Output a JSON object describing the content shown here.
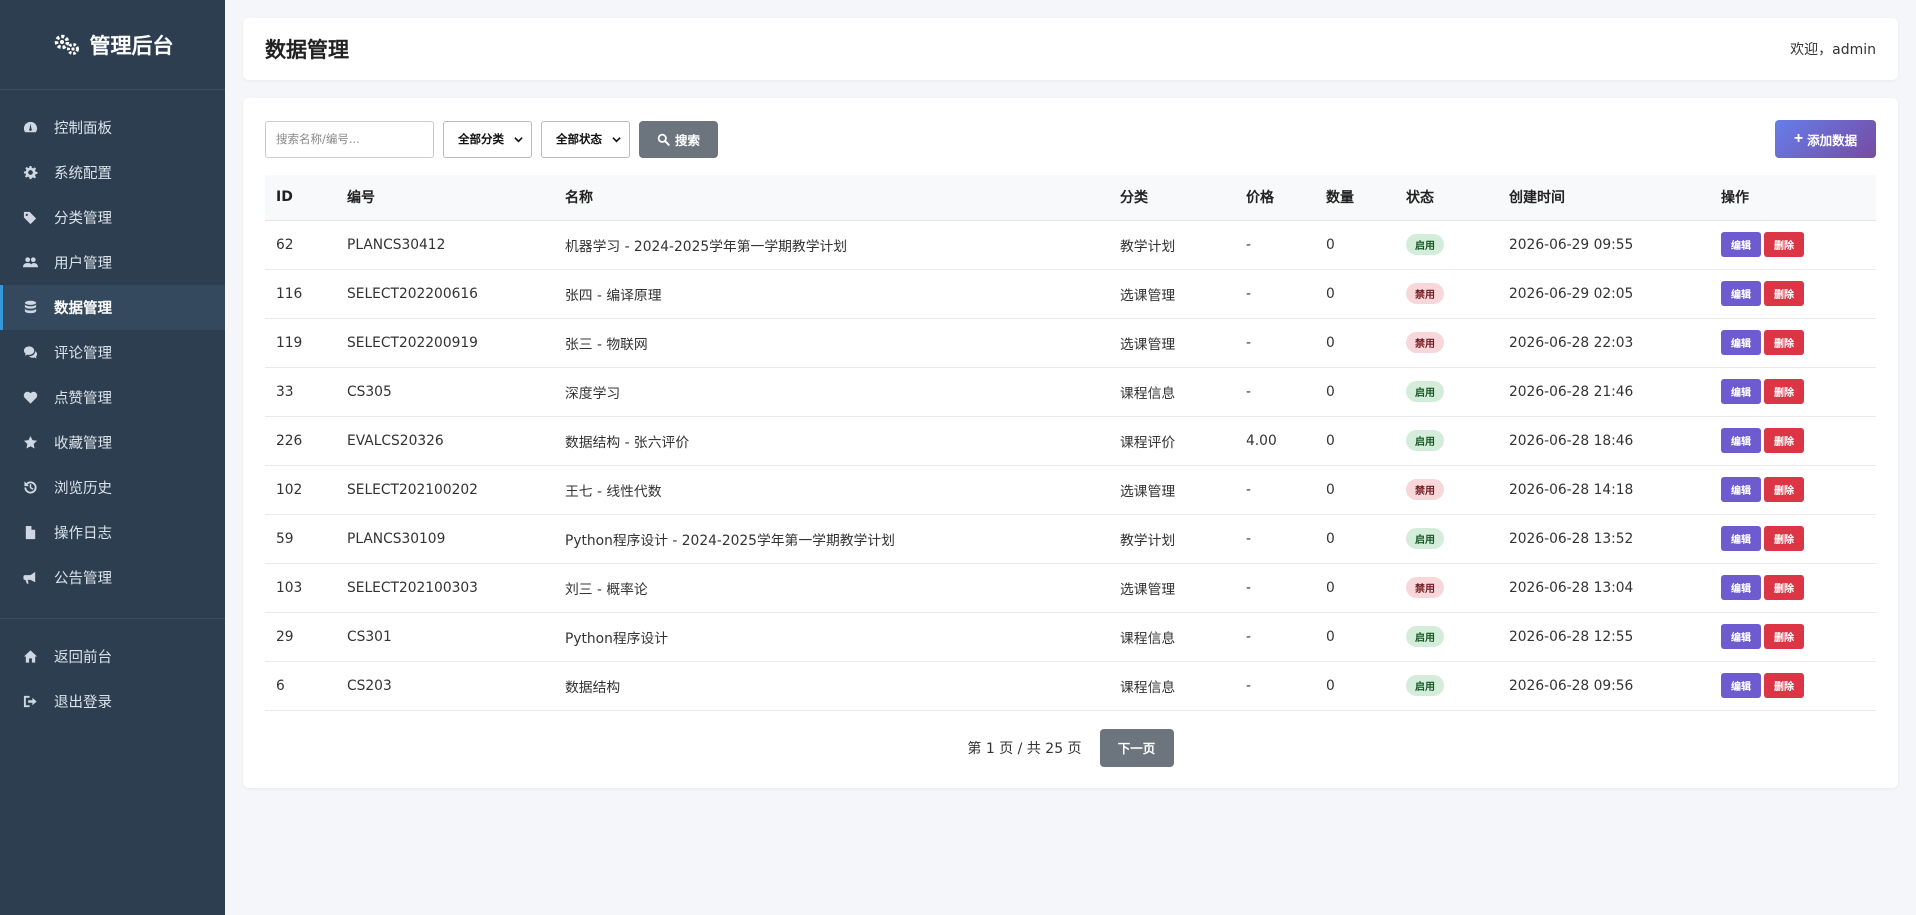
{
  "sidebar": {
    "brand": "管理后台",
    "items": [
      {
        "label": "控制面板",
        "icon": "dashboard-icon"
      },
      {
        "label": "系统配置",
        "icon": "gear-icon"
      },
      {
        "label": "分类管理",
        "icon": "tags-icon"
      },
      {
        "label": "用户管理",
        "icon": "users-icon"
      },
      {
        "label": "数据管理",
        "icon": "database-icon",
        "active": true
      },
      {
        "label": "评论管理",
        "icon": "comments-icon"
      },
      {
        "label": "点赞管理",
        "icon": "heart-icon"
      },
      {
        "label": "收藏管理",
        "icon": "star-icon"
      },
      {
        "label": "浏览历史",
        "icon": "history-icon"
      },
      {
        "label": "操作日志",
        "icon": "file-icon"
      },
      {
        "label": "公告管理",
        "icon": "bullhorn-icon"
      }
    ],
    "bottom": [
      {
        "label": "返回前台",
        "icon": "home-icon"
      },
      {
        "label": "退出登录",
        "icon": "sign-out-icon"
      }
    ]
  },
  "header": {
    "title": "数据管理",
    "welcome": "欢迎，admin"
  },
  "toolbar": {
    "search_placeholder": "搜索名称/编号...",
    "category_select": "全部分类",
    "status_select": "全部状态",
    "search_label": "搜索",
    "add_label": "添加数据"
  },
  "table": {
    "columns": [
      "ID",
      "编号",
      "名称",
      "分类",
      "价格",
      "数量",
      "状态",
      "创建时间",
      "操作"
    ],
    "edit_label": "编辑",
    "delete_label": "删除",
    "rows": [
      {
        "id": "62",
        "code": "PLANCS30412",
        "name": "机器学习 - 2024-2025学年第一学期教学计划",
        "category": "教学计划",
        "price": "-",
        "qty": "0",
        "status": "启用",
        "status_on": true,
        "created": "2026-06-29 09:55"
      },
      {
        "id": "116",
        "code": "SELECT202200616",
        "name": "张四 - 编译原理",
        "category": "选课管理",
        "price": "-",
        "qty": "0",
        "status": "禁用",
        "status_on": false,
        "created": "2026-06-29 02:05"
      },
      {
        "id": "119",
        "code": "SELECT202200919",
        "name": "张三 - 物联网",
        "category": "选课管理",
        "price": "-",
        "qty": "0",
        "status": "禁用",
        "status_on": false,
        "created": "2026-06-28 22:03"
      },
      {
        "id": "33",
        "code": "CS305",
        "name": "深度学习",
        "category": "课程信息",
        "price": "-",
        "qty": "0",
        "status": "启用",
        "status_on": true,
        "created": "2026-06-28 21:46"
      },
      {
        "id": "226",
        "code": "EVALCS20326",
        "name": "数据结构 - 张六评价",
        "category": "课程评价",
        "price": "4.00",
        "qty": "0",
        "status": "启用",
        "status_on": true,
        "created": "2026-06-28 18:46"
      },
      {
        "id": "102",
        "code": "SELECT202100202",
        "name": "王七 - 线性代数",
        "category": "选课管理",
        "price": "-",
        "qty": "0",
        "status": "禁用",
        "status_on": false,
        "created": "2026-06-28 14:18"
      },
      {
        "id": "59",
        "code": "PLANCS30109",
        "name": "Python程序设计 - 2024-2025学年第一学期教学计划",
        "category": "教学计划",
        "price": "-",
        "qty": "0",
        "status": "启用",
        "status_on": true,
        "created": "2026-06-28 13:52"
      },
      {
        "id": "103",
        "code": "SELECT202100303",
        "name": "刘三 - 概率论",
        "category": "选课管理",
        "price": "-",
        "qty": "0",
        "status": "禁用",
        "status_on": false,
        "created": "2026-06-28 13:04"
      },
      {
        "id": "29",
        "code": "CS301",
        "name": "Python程序设计",
        "category": "课程信息",
        "price": "-",
        "qty": "0",
        "status": "启用",
        "status_on": true,
        "created": "2026-06-28 12:55"
      },
      {
        "id": "6",
        "code": "CS203",
        "name": "数据结构",
        "category": "课程信息",
        "price": "-",
        "qty": "0",
        "status": "启用",
        "status_on": true,
        "created": "2026-06-28 09:56"
      }
    ]
  },
  "pagination": {
    "info": "第 1 页 / 共 25 页",
    "next_label": "下一页"
  }
}
